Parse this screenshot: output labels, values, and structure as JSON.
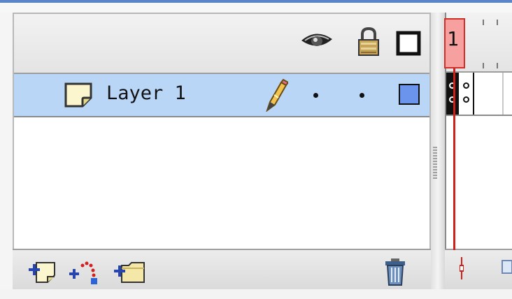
{
  "layers": {
    "header_icons": [
      "eye-icon",
      "lock-icon",
      "outline-icon"
    ],
    "rows": [
      {
        "name": "Layer 1",
        "selected": true,
        "visible_dot": "•",
        "lock_dot": "•",
        "outline_color": "#6b95ec"
      }
    ]
  },
  "timeline": {
    "current_frame": "1"
  },
  "footer": {
    "icons": [
      "insert-layer-icon",
      "add-motion-guide-icon",
      "insert-layer-folder-icon",
      "delete-layer-icon"
    ]
  },
  "colors": {
    "selection": "#b9d6f7",
    "playhead": "#d0201a",
    "accent": "#5a85c6"
  }
}
